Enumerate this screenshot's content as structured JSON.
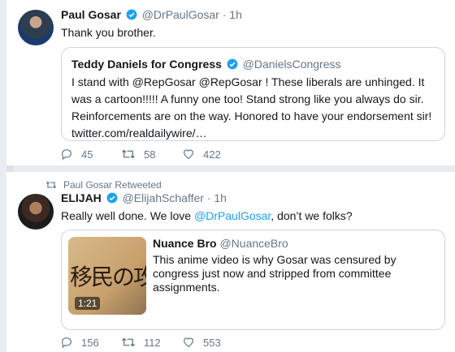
{
  "colors": {
    "accent": "#1da1f2",
    "muted": "#657786",
    "text": "#14171a",
    "border": "#ccd6dd",
    "background": "#e6ecf0"
  },
  "tweets": [
    {
      "author": {
        "name": "Paul Gosar",
        "handle": "@DrPaulGosar",
        "verified": true
      },
      "dot": "·",
      "time": "1h",
      "text": "Thank you brother.",
      "quote": {
        "author": {
          "name": "Teddy Daniels for Congress",
          "handle": "@DanielsCongress",
          "verified": true
        },
        "text": "I stand with @RepGosar @RepGosar !  These liberals are unhinged. It was a cartoon!!!!! A funny one too!  Stand strong like you always do sir.  Reinforcements are on the way.  Honored to have your endorsement sir! twitter.com/realdailywire/…"
      },
      "actions": {
        "replies": "45",
        "retweets": "58",
        "likes": "422"
      }
    },
    {
      "retweeted_by": "Paul Gosar Retweeted",
      "author": {
        "name": "ELIJAH",
        "handle": "@ElijahSchaffer",
        "verified": true
      },
      "dot": "·",
      "time": "1h",
      "text_before": "Really well done. We love ",
      "text_mention": "@DrPaulGosar",
      "text_after": ", don’t we folks?",
      "quote": {
        "author": {
          "name": "Nuance Bro",
          "handle": "@NuanceBro"
        },
        "text": "This anime video is why Gosar was censured by congress just now and stripped from committee assignments.",
        "media": {
          "thumbnail_text": "移民の攻撃",
          "duration": "1:21"
        }
      },
      "actions": {
        "replies": "156",
        "retweets": "112",
        "likes": "553"
      }
    }
  ]
}
